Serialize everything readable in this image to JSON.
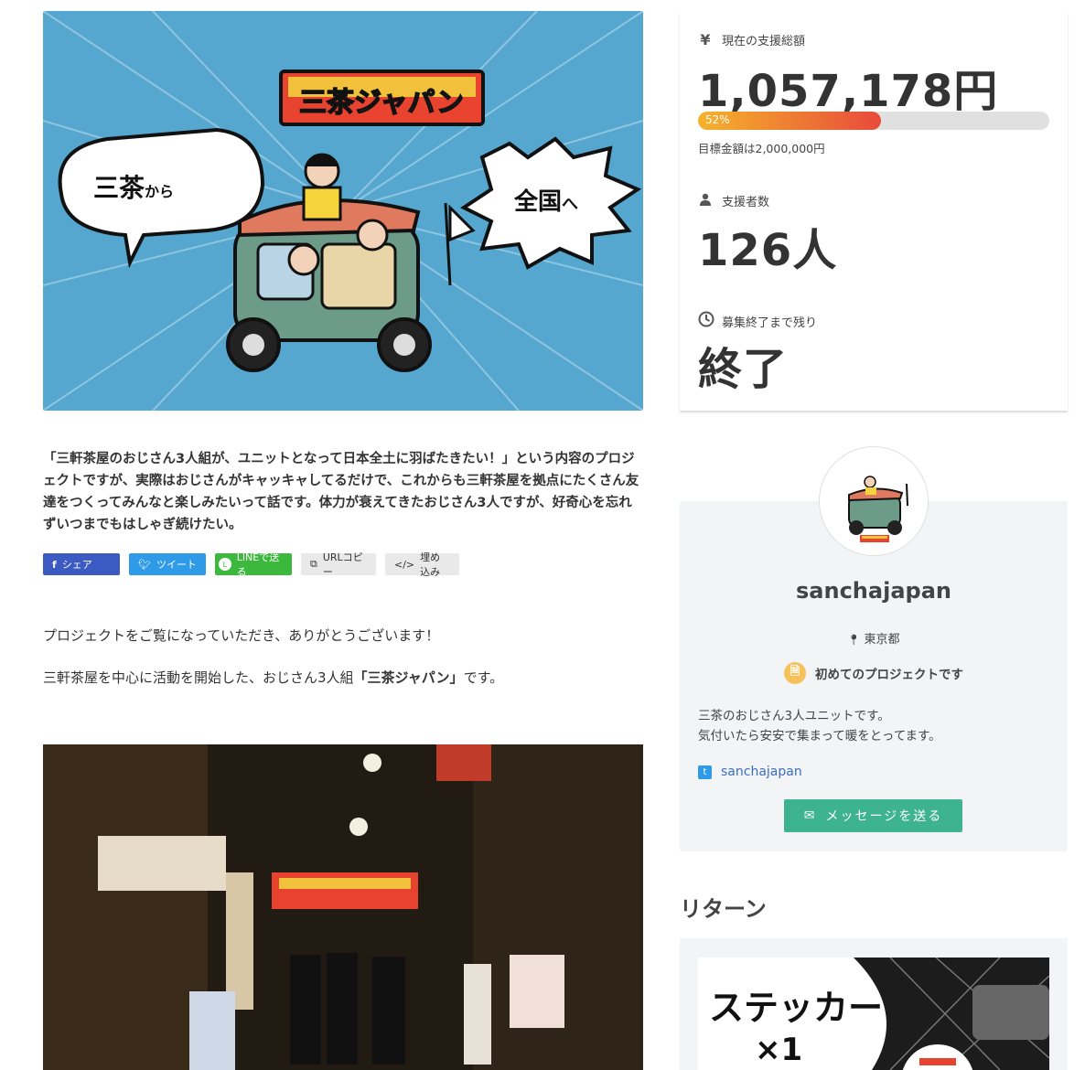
{
  "hero": {
    "logo_text": "三茶ジャパン",
    "bubble_left_main": "三茶",
    "bubble_left_sub": "から",
    "bubble_right_main": "全国",
    "bubble_right_sub": "へ"
  },
  "lead": "「三軒茶屋のおじさん3人組が、ユニットとなって日本全土に羽ばたきたい！」という内容のプロジェクトですが、実際はおじさんがキャッキャしてるだけで、これからも三軒茶屋を拠点にたくさん友達をつくってみんなと楽しみたいって話です。体力が衰えてきたおじさん3人ですが、好奇心を忘れずいつまでもはしゃぎ続けたい。",
  "share": {
    "facebook": "シェア",
    "twitter": "ツイート",
    "line": "LINEで送る",
    "url_copy": "URLコピー",
    "embed": "埋め込み"
  },
  "body": {
    "p1": "プロジェクトをご覧になっていただき、ありがとうございます！",
    "p2_before": "三軒茶屋を中心に活動を開始した、おじさん3人組",
    "p2_bold": "「三茶ジャパン」",
    "p2_after": "です。"
  },
  "stats": {
    "total_label": "現在の支援総額",
    "total_value": "1,057,178円",
    "progress_percent": 52,
    "progress_label": "52%",
    "goal_text": "目標金額は2,000,000円",
    "supporters_label": "支援者数",
    "supporters_value": "126人",
    "remaining_label": "募集終了まで残り",
    "remaining_value": "終了"
  },
  "owner": {
    "name": "sanchajapan",
    "location": "東京都",
    "first_project": "初めてのプロジェクトです",
    "bio_line1": "三茶のおじさん3人ユニットです。",
    "bio_line2": "気付いたら安安で集まって暖をとってます。",
    "twitter_handle": "sanchajapan",
    "message_button": "メッセージを送る"
  },
  "returns": {
    "title": "リターン",
    "first_item_line1": "ステッカー",
    "first_item_line2": "×1"
  },
  "colors": {
    "hero_bg": "#55a7cf",
    "accent_green": "#3db38f",
    "progress_start": "#f5b32b",
    "progress_end": "#e84a3b"
  }
}
